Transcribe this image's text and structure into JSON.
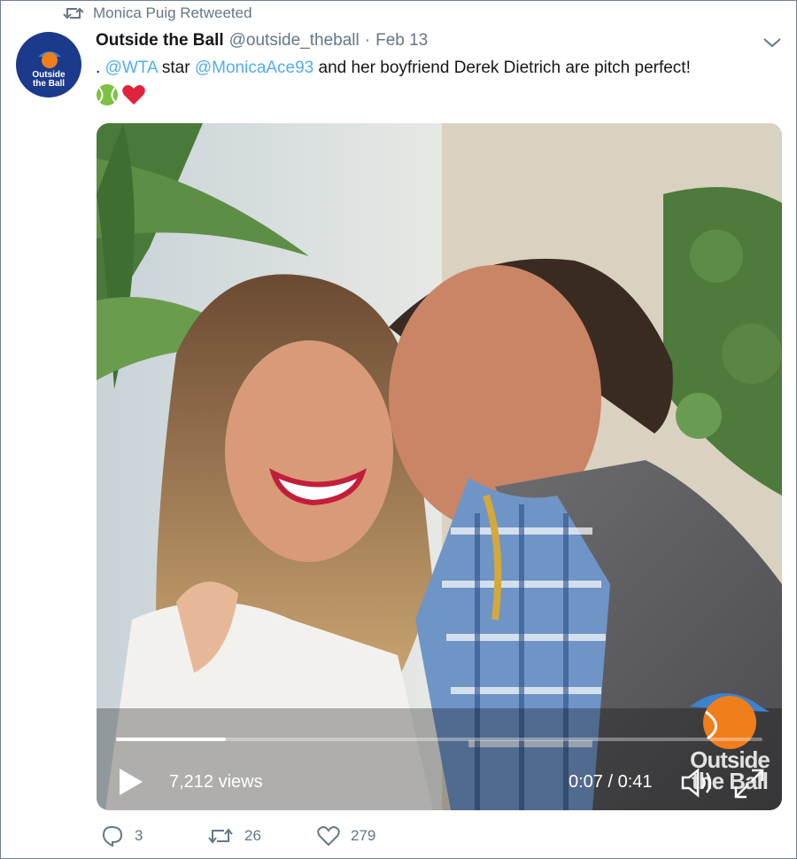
{
  "retweet_banner": {
    "icon": "retweet-icon",
    "text": "Monica Puig Retweeted"
  },
  "tweet": {
    "author": {
      "display_name": "Outside the Ball",
      "handle": "@outside_theball",
      "avatar_text_line1": "Outside",
      "avatar_text_line2": "the Ball"
    },
    "separator": "·",
    "date": "Feb 13",
    "text": {
      "prefix": ". ",
      "mention1": "@WTA",
      "part2": " star ",
      "mention2": "@MonicaAce93",
      "part3": " and her boyfriend Derek Dietrich are pitch perfect!"
    },
    "emojis": [
      "tennis-ball",
      "red-heart"
    ]
  },
  "video": {
    "views": "7,212 views",
    "time": "0:07 / 0:41",
    "progress": 0.17,
    "watermark_line1": "Outside",
    "watermark_line2": "the Ball"
  },
  "actions": {
    "reply_count": "3",
    "retweet_count": "26",
    "like_count": "279"
  },
  "colors": {
    "link": "#55acee",
    "muted": "#657786",
    "avatar_bg": "#1b3a8c",
    "brand_orange": "#f07e1b"
  }
}
